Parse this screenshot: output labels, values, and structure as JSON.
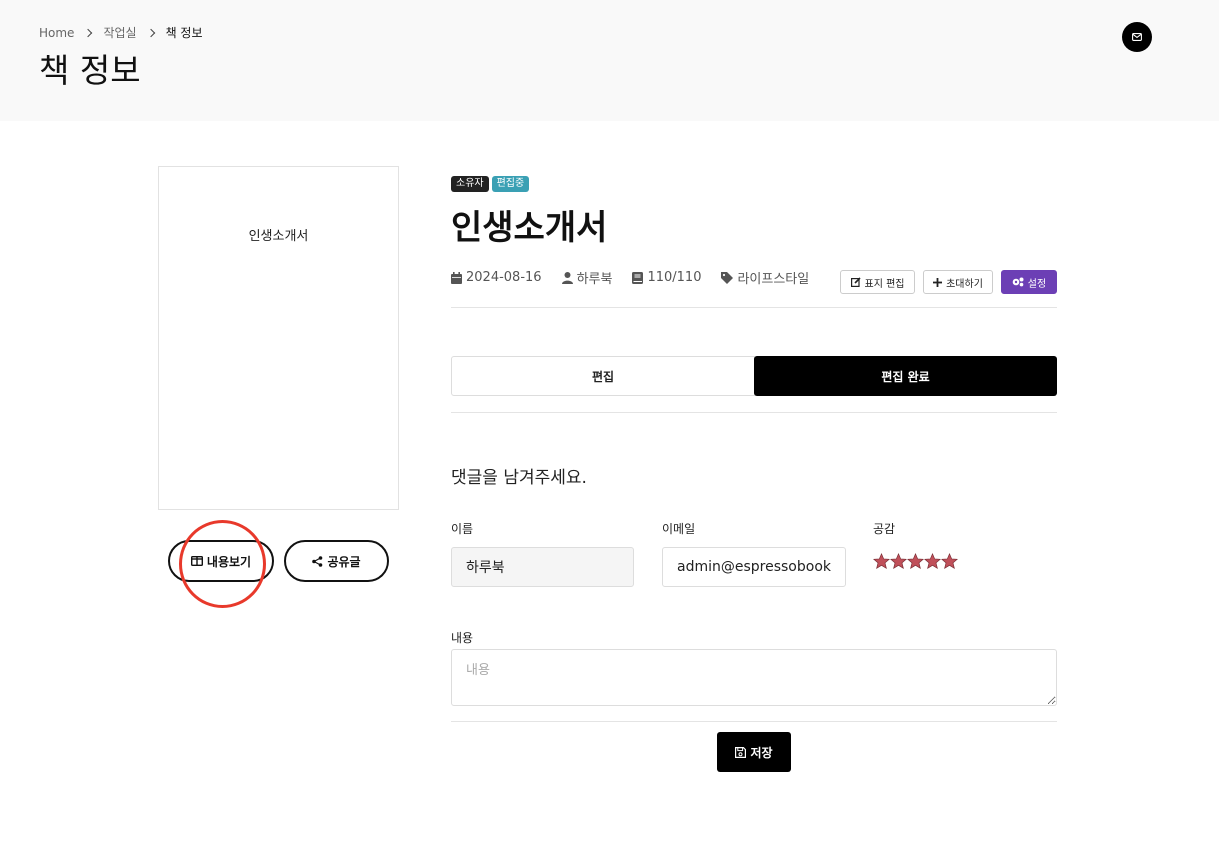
{
  "breadcrumb": {
    "home": "Home",
    "workspace": "작업실",
    "current": "책 정보"
  },
  "page": {
    "title": "책 정보"
  },
  "book": {
    "cover_title": "인생소개서",
    "title": "인생소개서",
    "badges": {
      "owner": "소유자",
      "editing": "편집중"
    },
    "meta": {
      "date": "2024-08-16",
      "author": "하루북",
      "pages": "110/110",
      "category": "라이프스타일"
    }
  },
  "actions": {
    "cover_edit": "표지 편집",
    "invite": "초대하기",
    "settings": "설정"
  },
  "cover_buttons": {
    "view": "내용보기",
    "share": "공유글"
  },
  "tabs": {
    "edit": "편집",
    "done": "편집 완료"
  },
  "comment": {
    "heading": "댓글을 남겨주세요.",
    "name_label": "이름",
    "name_value": "하루북",
    "email_label": "이메일",
    "email_value": "admin@espressobook",
    "rating_label": "공감",
    "rating": 5,
    "content_label": "내용",
    "content_placeholder": "내용",
    "save": "저장"
  },
  "colors": {
    "accent_purple": "#6c3fb5",
    "badge_teal": "#3aa0b4",
    "star": "#c0505a",
    "annotation_red": "#e8392b"
  }
}
